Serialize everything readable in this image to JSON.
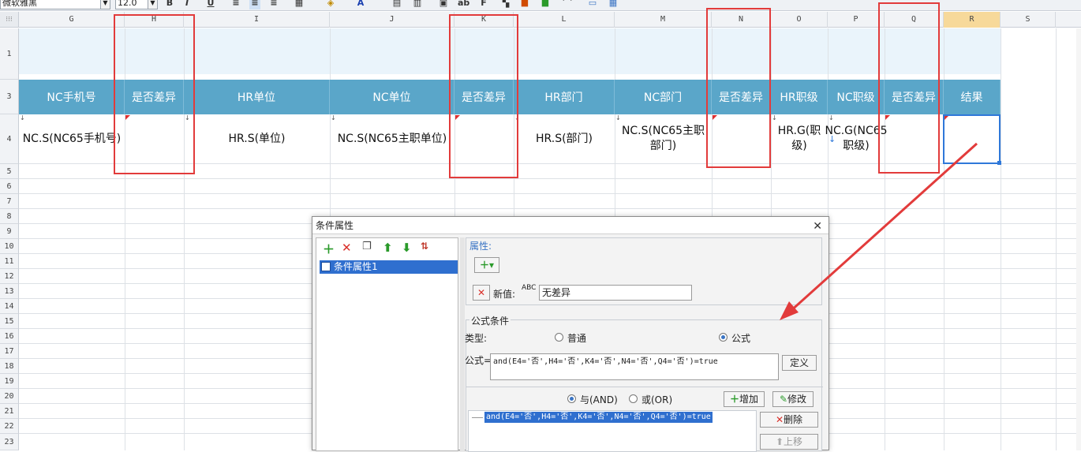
{
  "toolbar": {
    "font_name": "微软雅黑",
    "font_size": "12.0",
    "bold": "B",
    "italic": "I",
    "underline": "U"
  },
  "columns": [
    "G",
    "H",
    "I",
    "J",
    "K",
    "L",
    "M",
    "N",
    "O",
    "P",
    "Q",
    "R",
    "S"
  ],
  "rows": [
    "1",
    "3",
    "4",
    "5",
    "6",
    "7",
    "8",
    "9",
    "10",
    "11",
    "12",
    "13",
    "14",
    "15",
    "16",
    "17",
    "18",
    "19",
    "20",
    "21",
    "22",
    "23"
  ],
  "corner_label": "⁝⁝⁝",
  "sheet": {
    "headers": [
      "NC手机号",
      "是否差异",
      "HR单位",
      "NC单位",
      "是否差异",
      "HR部门",
      "NC部门",
      "是否差异",
      "HR职级",
      "NC职级",
      "是否差异",
      "结果"
    ],
    "cells": [
      "NC.S(NC65手机号)",
      "",
      "HR.S(单位)",
      "NC.S(NC65主职单位)",
      "",
      "HR.S(部门)",
      "NC.S(NC65主职部门)",
      "",
      "HR.G(职级)",
      "NC.G(NC65职级)",
      "",
      ""
    ]
  },
  "dialog": {
    "title": "条件属性",
    "tree_item": "条件属性1",
    "attributes_label": "属性:",
    "new_value_label": "新值:",
    "new_value": "无差异",
    "formula_condition_label": "公式条件",
    "type_label": "类型:",
    "type_normal": "普通",
    "type_formula": "公式",
    "formula_label": "公式=",
    "formula": "and(E4='否',H4='否',K4='否',N4='否',Q4='否')=true",
    "define_button": "定义",
    "and_label": "与(AND)",
    "or_label": "或(OR)",
    "add_button": "增加",
    "modify_button": "修改",
    "delete_button": "删除",
    "move_up_button": "上移",
    "condition_item": "and(E4='否',H4='否',K4='否',N4='否',Q4='否')=true"
  },
  "colors": {
    "header_bg": "#5aa6c9",
    "band_bg": "#eaf4fb",
    "highlight_red": "#e23b3b",
    "selection_blue": "#2f78d9"
  }
}
